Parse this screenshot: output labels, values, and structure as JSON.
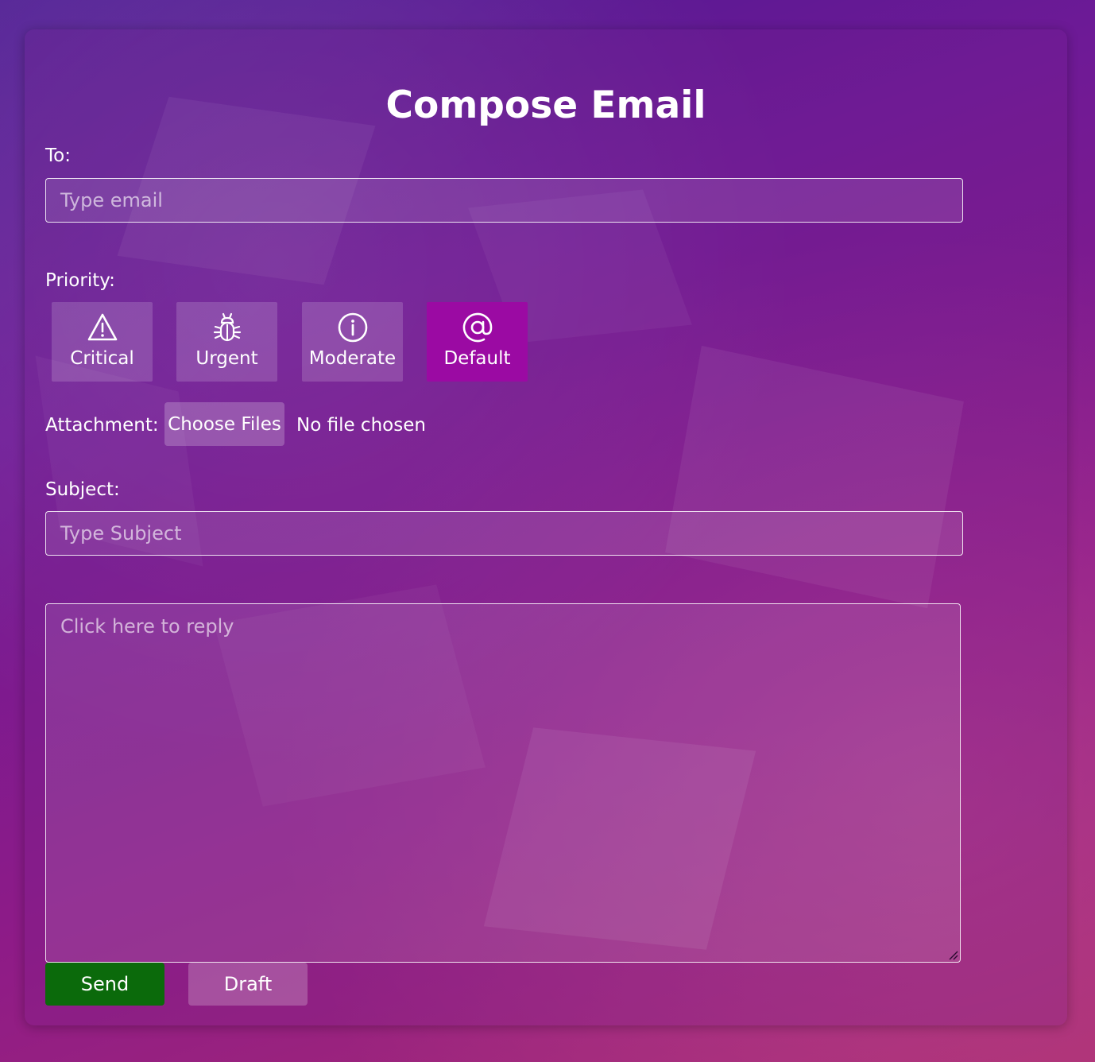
{
  "page": {
    "title": "Compose Email"
  },
  "to": {
    "label": "To:",
    "placeholder": "Type email"
  },
  "priority": {
    "label": "Priority:",
    "selected": "Default",
    "options": [
      {
        "label": "Critical",
        "icon": "warning-triangle-icon"
      },
      {
        "label": "Urgent",
        "icon": "bug-icon"
      },
      {
        "label": "Moderate",
        "icon": "info-circle-icon"
      },
      {
        "label": "Default",
        "icon": "at-sign-icon"
      }
    ]
  },
  "attachment": {
    "label": "Attachment:",
    "button_label": "Choose Files",
    "status": "No file chosen"
  },
  "subject": {
    "label": "Subject:",
    "placeholder": "Type Subject"
  },
  "body": {
    "placeholder": "Click here to reply"
  },
  "actions": {
    "send_label": "Send",
    "draft_label": "Draft"
  },
  "colors": {
    "selected_priority": "#9b0aa3",
    "send_button": "#0b6a0b",
    "background_start": "#4a1790",
    "background_end": "#a82c72"
  }
}
